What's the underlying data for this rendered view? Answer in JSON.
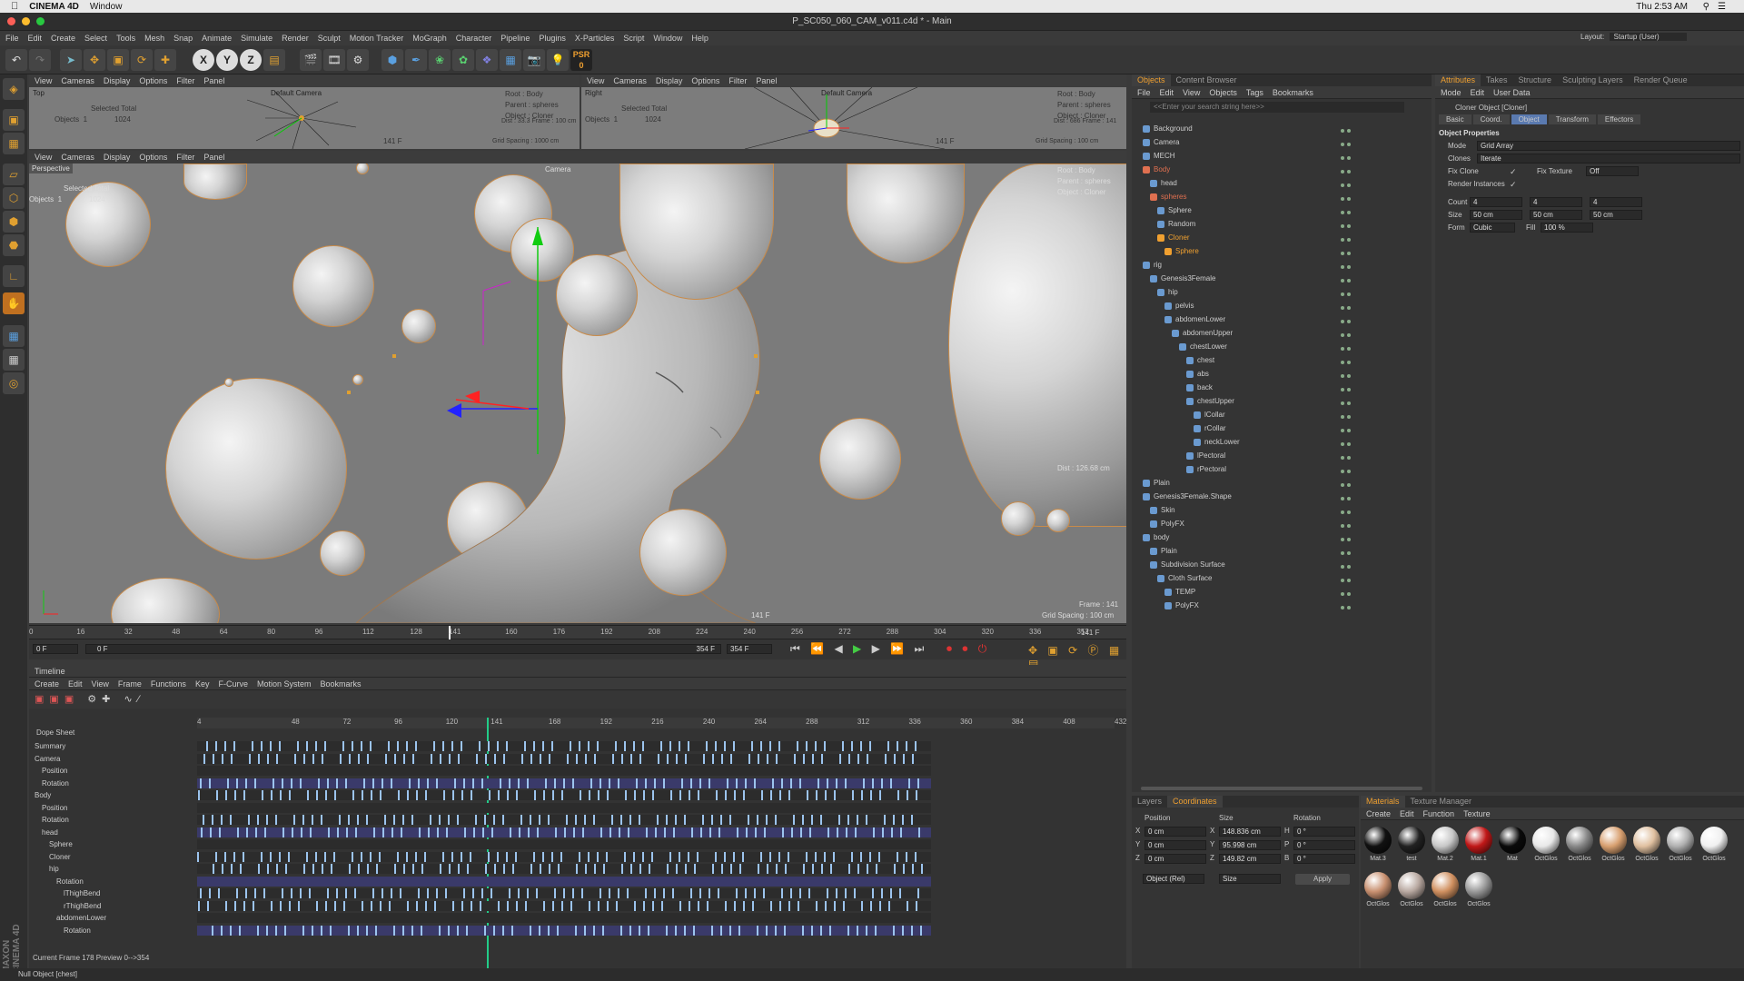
{
  "mac": {
    "app": "CINEMA 4D",
    "menu": "Window",
    "clock": "Thu 2:53 AM"
  },
  "window": {
    "title": "P_SC050_060_CAM_v011.c4d * - Main"
  },
  "menubar": [
    "File",
    "Edit",
    "Create",
    "Select",
    "Tools",
    "Mesh",
    "Snap",
    "Animate",
    "Simulate",
    "Render",
    "Sculpt",
    "Motion Tracker",
    "MoGraph",
    "Character",
    "Pipeline",
    "Plugins",
    "X-Particles",
    "Script",
    "Window",
    "Help"
  ],
  "layout": {
    "label": "Layout:",
    "value": "Startup (User)"
  },
  "toolbar": {
    "x": "X",
    "y": "Y",
    "z": "Z",
    "psr": "PSR"
  },
  "viewport_menu": [
    "View",
    "Cameras",
    "Display",
    "Options",
    "Filter",
    "Panel"
  ],
  "top_view": {
    "name": "Top",
    "camera": "Default Camera",
    "selected": "Selected Total",
    "objects_label": "Objects",
    "objects_sel": "1",
    "objects_total": "1024",
    "root": "Root : Body",
    "parent": "Parent : spheres",
    "object": "Object : Cloner",
    "dist": "Dist : 33.3 Frame : 100 cm",
    "frame": "141 F",
    "grid": "Grid Spacing : 1000 cm"
  },
  "right_view": {
    "name": "Right",
    "camera": "Default Camera",
    "selected": "Selected Total",
    "objects_label": "Objects",
    "objects_sel": "1",
    "objects_total": "1024",
    "root": "Root : Body",
    "parent": "Parent : spheres",
    "object": "Object : Cloner",
    "dist": "Dist : 686 Frame : 141",
    "frame": "141 F",
    "grid": "Grid Spacing : 100 cm"
  },
  "persp_view": {
    "name": "Perspective",
    "camera": "Camera",
    "selected": "Selected Total",
    "objects_label": "Objects",
    "objects_sel": "1",
    "objects_total": "1024",
    "root": "Root : Body",
    "parent": "Parent : spheres",
    "object": "Object : Cloner",
    "dist": "Dist : 126.68 cm",
    "frame_info": "Frame : 141",
    "frame": "141 F",
    "grid": "Grid Spacing : 100 cm"
  },
  "ruler": {
    "ticks": [
      "0",
      "16",
      "32",
      "48",
      "64",
      "80",
      "96",
      "112",
      "128",
      "141",
      "160",
      "176",
      "192",
      "208",
      "224",
      "240",
      "256",
      "272",
      "288",
      "304",
      "320",
      "336",
      "352"
    ],
    "current": "141 F"
  },
  "transport": {
    "start": "0 F",
    "range_start": "0 F",
    "range_end": "354 F",
    "end": "354 F"
  },
  "timeline": {
    "title": "Timeline",
    "menu": [
      "Create",
      "Edit",
      "View",
      "Frame",
      "Functions",
      "Key",
      "F-Curve",
      "Motion System",
      "Bookmarks"
    ],
    "mode": "Dope Sheet",
    "ticks": [
      "4",
      "48",
      "72",
      "96",
      "120",
      "141",
      "168",
      "192",
      "216",
      "240",
      "264",
      "288",
      "312",
      "336",
      "360",
      "384",
      "408",
      "432"
    ],
    "tracks": [
      {
        "label": "Summary",
        "indent": 0
      },
      {
        "label": "Camera",
        "indent": 0
      },
      {
        "label": "Position",
        "indent": 1
      },
      {
        "label": "Rotation",
        "indent": 1
      },
      {
        "label": "Body",
        "indent": 0
      },
      {
        "label": "Position",
        "indent": 1
      },
      {
        "label": "Rotation",
        "indent": 1
      },
      {
        "label": "head",
        "indent": 1
      },
      {
        "label": "Sphere",
        "indent": 2
      },
      {
        "label": "Cloner",
        "indent": 2
      },
      {
        "label": "hip",
        "indent": 2
      },
      {
        "label": "Rotation",
        "indent": 3
      },
      {
        "label": "lThighBend",
        "indent": 4
      },
      {
        "label": "rThighBend",
        "indent": 4
      },
      {
        "label": "abdomenLower",
        "indent": 3
      },
      {
        "label": "Rotation",
        "indent": 4
      }
    ],
    "status": "Current Frame  178  Preview  0-->354"
  },
  "objects_panel": {
    "tabs": [
      "Objects",
      "Content Browser"
    ],
    "menu": [
      "File",
      "Edit",
      "View",
      "Objects",
      "Tags",
      "Bookmarks"
    ],
    "search_placeholder": "<<Enter your search string here>>",
    "rows": [
      {
        "name": "Background",
        "indent": 0,
        "color": "#ccc"
      },
      {
        "name": "Camera",
        "indent": 0,
        "color": "#ccc"
      },
      {
        "name": "MECH",
        "indent": 0,
        "color": "#ccc"
      },
      {
        "name": "Body",
        "indent": 0,
        "color": "#e07050"
      },
      {
        "name": "head",
        "indent": 1,
        "color": "#ccc"
      },
      {
        "name": "spheres",
        "indent": 1,
        "color": "#e07050"
      },
      {
        "name": "Sphere",
        "indent": 2,
        "color": "#ccc"
      },
      {
        "name": "Random",
        "indent": 2,
        "color": "#ccc"
      },
      {
        "name": "Cloner",
        "indent": 2,
        "color": "#f0a030"
      },
      {
        "name": "Sphere",
        "indent": 3,
        "color": "#f0a030"
      },
      {
        "name": "rig",
        "indent": 0,
        "color": "#ccc"
      },
      {
        "name": "Genesis3Female",
        "indent": 1,
        "color": "#ccc"
      },
      {
        "name": "hip",
        "indent": 2,
        "color": "#ccc"
      },
      {
        "name": "pelvis",
        "indent": 3,
        "color": "#ccc"
      },
      {
        "name": "abdomenLower",
        "indent": 3,
        "color": "#ccc"
      },
      {
        "name": "abdomenUpper",
        "indent": 4,
        "color": "#ccc"
      },
      {
        "name": "chestLower",
        "indent": 5,
        "color": "#ccc"
      },
      {
        "name": "chest",
        "indent": 6,
        "color": "#ccc"
      },
      {
        "name": "abs",
        "indent": 6,
        "color": "#ccc"
      },
      {
        "name": "back",
        "indent": 6,
        "color": "#ccc"
      },
      {
        "name": "chestUpper",
        "indent": 6,
        "color": "#ccc"
      },
      {
        "name": "lCollar",
        "indent": 7,
        "color": "#ccc"
      },
      {
        "name": "rCollar",
        "indent": 7,
        "color": "#ccc"
      },
      {
        "name": "neckLower",
        "indent": 7,
        "color": "#ccc"
      },
      {
        "name": "lPectoral",
        "indent": 6,
        "color": "#ccc"
      },
      {
        "name": "rPectoral",
        "indent": 6,
        "color": "#ccc"
      },
      {
        "name": "Plain",
        "indent": 0,
        "color": "#ccc"
      },
      {
        "name": "Genesis3Female.Shape",
        "indent": 0,
        "color": "#ccc"
      },
      {
        "name": "Skin",
        "indent": 1,
        "color": "#ccc"
      },
      {
        "name": "PolyFX",
        "indent": 1,
        "color": "#ccc"
      },
      {
        "name": "body",
        "indent": 0,
        "color": "#ccc"
      },
      {
        "name": "Plain",
        "indent": 1,
        "color": "#ccc"
      },
      {
        "name": "Subdivision Surface",
        "indent": 1,
        "color": "#ccc"
      },
      {
        "name": "Cloth Surface",
        "indent": 2,
        "color": "#ccc"
      },
      {
        "name": "TEMP",
        "indent": 3,
        "color": "#ccc"
      },
      {
        "name": "PolyFX",
        "indent": 3,
        "color": "#ccc"
      }
    ]
  },
  "attributes": {
    "tabs": [
      "Attributes",
      "Takes",
      "Structure",
      "Sculpting Layers",
      "Render Queue"
    ],
    "menu": [
      "Mode",
      "Edit",
      "User Data"
    ],
    "object_title": "Cloner Object [Cloner]",
    "subtabs": [
      "Basic",
      "Coord.",
      "Object",
      "Transform",
      "Effectors"
    ],
    "section": "Object Properties",
    "mode_label": "Mode",
    "mode_value": "Grid Array",
    "clones_label": "Clones",
    "clones_value": "Iterate",
    "fix_clone": "Fix Clone",
    "fix_texture": "Fix Texture",
    "fix_texture_value": "Off",
    "render_instances": "Render Instances",
    "count_label": "Count",
    "count": [
      "4",
      "4",
      "4"
    ],
    "size_label": "Size",
    "size": [
      "50 cm",
      "50 cm",
      "50 cm"
    ],
    "form_label": "Form",
    "form_value": "Cubic",
    "fill_label": "Fill",
    "fill_value": "100 %"
  },
  "coordinates": {
    "tabs": [
      "Layers",
      "Coordinates"
    ],
    "headers": [
      "Position",
      "Size",
      "Rotation"
    ],
    "rows": [
      {
        "axis": "X",
        "pos": "0 cm",
        "size_axis": "X",
        "size": "148.836 cm",
        "rot_axis": "H",
        "rot": "0 °"
      },
      {
        "axis": "Y",
        "pos": "0 cm",
        "size_axis": "Y",
        "size": "95.998 cm",
        "rot_axis": "P",
        "rot": "0 °"
      },
      {
        "axis": "Z",
        "pos": "0 cm",
        "size_axis": "Z",
        "size": "149.82 cm",
        "rot_axis": "B",
        "rot": "0 °"
      }
    ],
    "mode": "Object (Rel)",
    "size_mode": "Size",
    "apply": "Apply"
  },
  "materials": {
    "tabs": [
      "Materials",
      "Texture Manager"
    ],
    "menu": [
      "Create",
      "Edit",
      "Function",
      "Texture"
    ],
    "items": [
      {
        "label": "Mat.3",
        "color": "#111"
      },
      {
        "label": "test",
        "color": "#222"
      },
      {
        "label": "Mat.2",
        "color": "#c8c8c8"
      },
      {
        "label": "Mat.1",
        "color": "#c01818"
      },
      {
        "label": "Mat",
        "color": "#0a0a0a"
      },
      {
        "label": "OctGlos",
        "color": "#e8e8e8"
      },
      {
        "label": "OctGlos",
        "color": "#888"
      },
      {
        "label": "OctGlos",
        "color": "#d8a070"
      },
      {
        "label": "OctGlos",
        "color": "#e0c0a0"
      },
      {
        "label": "OctGlos",
        "color": "#b0b0b0"
      },
      {
        "label": "OctGlos",
        "color": "#f0f0f0"
      },
      {
        "label": "OctGlos",
        "color": "#c89070"
      },
      {
        "label": "OctGlos",
        "color": "#b8a8a0"
      },
      {
        "label": "OctGlos",
        "color": "#d09060"
      },
      {
        "label": "OctGlos",
        "color": "#999"
      }
    ]
  },
  "status": {
    "text": "Null Object [chest]",
    "brand": "MAXON CINEMA 4D"
  }
}
